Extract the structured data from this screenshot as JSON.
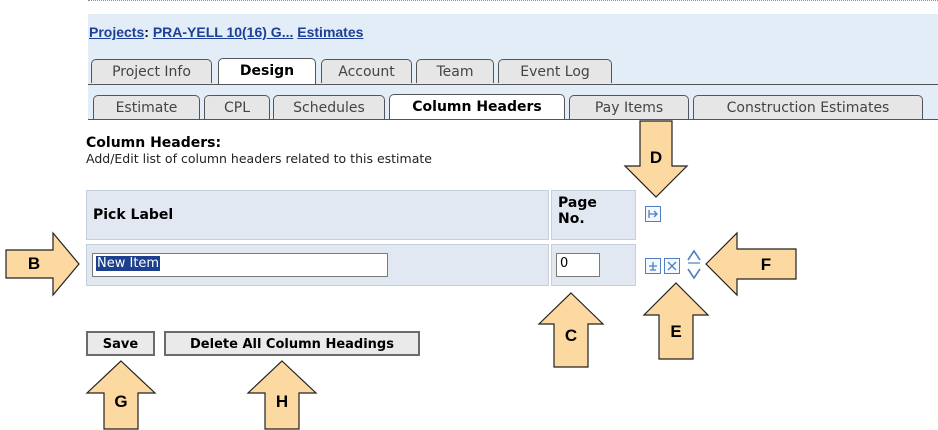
{
  "breadcrumb": {
    "projects_label": "Projects",
    "separator": ":",
    "project_link": "PRA-YELL 10(16) G...",
    "estimates_link": "Estimates"
  },
  "main_tabs": [
    {
      "label": "Project Info",
      "active": false
    },
    {
      "label": "Design",
      "active": true
    },
    {
      "label": "Account",
      "active": false
    },
    {
      "label": "Team",
      "active": false
    },
    {
      "label": "Event Log",
      "active": false
    }
  ],
  "sub_tabs": [
    {
      "label": "Estimate",
      "active": false
    },
    {
      "label": "CPL",
      "active": false
    },
    {
      "label": "Schedules",
      "active": false
    },
    {
      "label": "Column Headers",
      "active": true
    },
    {
      "label": "Pay Items",
      "active": false
    },
    {
      "label": "Construction Estimates",
      "active": false
    }
  ],
  "section": {
    "title": "Column Headers:",
    "description": "Add/Edit list of column headers related to this estimate"
  },
  "table": {
    "col_pick_label": "Pick Label",
    "col_page_no": "Page No.",
    "row": {
      "pick_label_value": "New Item",
      "page_no_value": "0"
    }
  },
  "buttons": {
    "save": "Save",
    "delete_all": "Delete All Column Headings"
  },
  "callouts": {
    "B": "B",
    "C": "C",
    "D": "D",
    "E": "E",
    "F": "F",
    "G": "G",
    "H": "H"
  },
  "colors": {
    "header_bg": "#e3edf7",
    "cell_bg": "#e1e8f2",
    "link": "#1c3f97",
    "callout_fill": "#fcd9a0",
    "icon_blue": "#4f7fc0"
  }
}
